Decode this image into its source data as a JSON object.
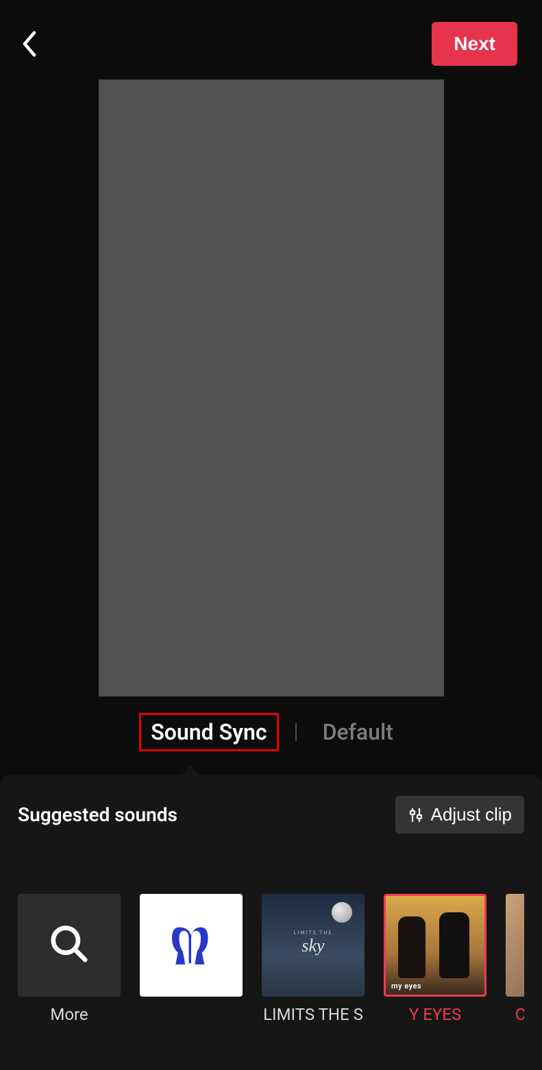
{
  "header": {
    "back_icon": "chevron-left",
    "next_label": "Next"
  },
  "tabs": {
    "active": "Sound Sync",
    "inactive": "Default"
  },
  "panel": {
    "title": "Suggested sounds",
    "adjust_label": "Adjust clip",
    "sounds": [
      {
        "id": "more",
        "label": "More",
        "icon": "search-icon",
        "selected": false
      },
      {
        "id": "track1",
        "label": "",
        "selected": false,
        "art": "two-blue-figures"
      },
      {
        "id": "track2",
        "label": "LIMITS THE S",
        "selected": false,
        "art": "sky-moon"
      },
      {
        "id": "track3",
        "label": "Y EYES",
        "selected": true,
        "art": "sunset-duo",
        "art_caption": "my eyes"
      },
      {
        "id": "track4",
        "label": "CL",
        "selected": true,
        "art": "partial"
      }
    ]
  },
  "colors": {
    "accent": "#e7334b",
    "highlight_box": "#e60000",
    "selected": "#f03a52"
  }
}
